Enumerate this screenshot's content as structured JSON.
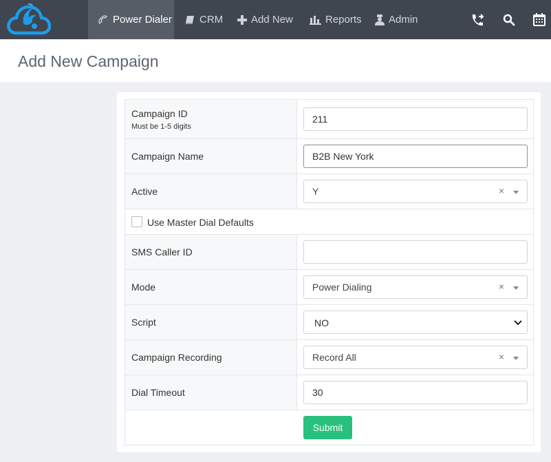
{
  "nav": {
    "items": [
      {
        "label": "Power Dialer",
        "icon": "phone-handset-icon",
        "active": true
      },
      {
        "label": "CRM",
        "icon": "book-icon",
        "active": false
      },
      {
        "label": "Add New",
        "icon": "plus-icon",
        "active": false
      },
      {
        "label": "Reports",
        "icon": "bar-chart-icon",
        "active": false
      },
      {
        "label": "Admin",
        "icon": "admin-user-icon",
        "active": false
      }
    ],
    "right_icons": [
      "call-forward-icon",
      "search-icon",
      "calendar-icon"
    ]
  },
  "page": {
    "title": "Add New Campaign"
  },
  "form": {
    "campaign_id": {
      "label": "Campaign ID",
      "hint": "Must be 1-5 digits",
      "value": "211"
    },
    "campaign_name": {
      "label": "Campaign Name",
      "value": "B2B New York"
    },
    "active": {
      "label": "Active",
      "value": "Y",
      "clear": "×"
    },
    "master_dial": {
      "label": "Use Master Dial Defaults",
      "checked": false
    },
    "sms_caller_id": {
      "label": "SMS Caller ID",
      "value": ""
    },
    "mode": {
      "label": "Mode",
      "value": "Power Dialing",
      "clear": "×"
    },
    "script": {
      "label": "Script",
      "value": "NO"
    },
    "campaign_recording": {
      "label": "Campaign Recording",
      "value": "Record All",
      "clear": "×"
    },
    "dial_timeout": {
      "label": "Dial Timeout",
      "value": "30"
    },
    "submit_label": "Submit"
  },
  "colors": {
    "nav_bg": "#3f4650",
    "nav_active_bg": "#565d66",
    "logo_blue": "#1f9be6",
    "submit_green": "#28c07c"
  }
}
